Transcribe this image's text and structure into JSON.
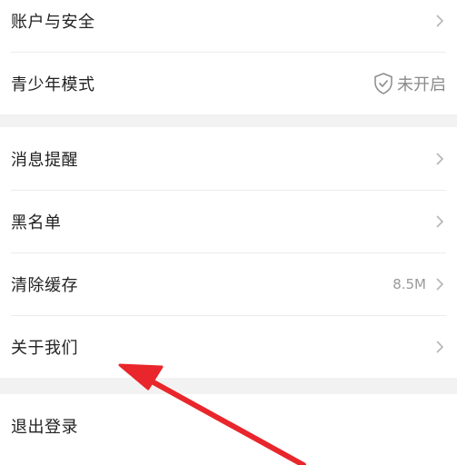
{
  "settings": {
    "group1": [
      {
        "label": "账户与安全"
      },
      {
        "label": "青少年模式",
        "status": "未开启"
      }
    ],
    "group2": [
      {
        "label": "消息提醒"
      },
      {
        "label": "黑名单"
      },
      {
        "label": "清除缓存",
        "value": "8.5M"
      },
      {
        "label": "关于我们"
      }
    ],
    "group3": [
      {
        "label": "退出登录"
      }
    ]
  },
  "icons": {
    "chevron": "chevron-right-icon",
    "shield": "shield-check-icon"
  },
  "colors": {
    "arrow": "#e8262b",
    "background": "#f2f2f2",
    "row_background": "#ffffff",
    "muted_text": "#9a9a9a"
  }
}
